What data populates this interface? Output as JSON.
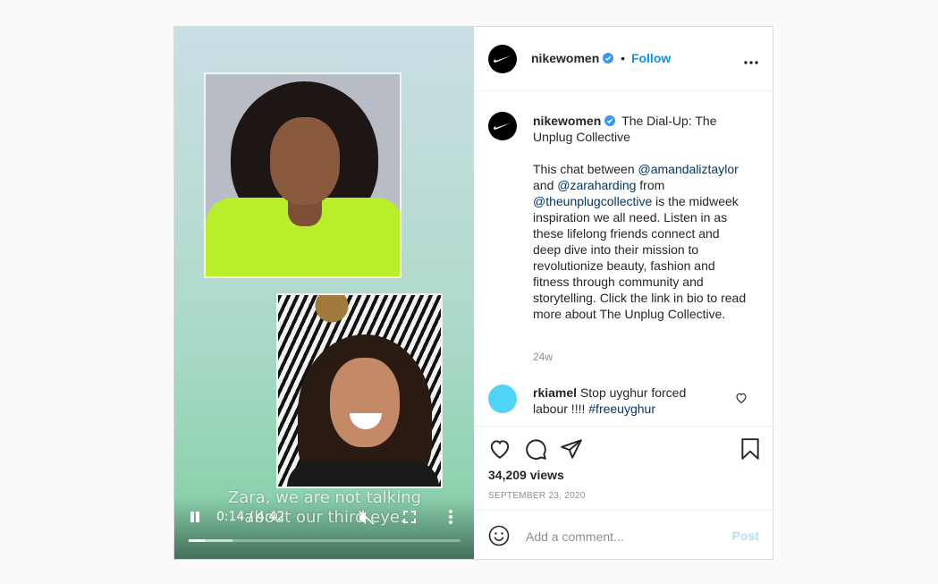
{
  "video": {
    "caption_line1": "Zara, we are not talking",
    "caption_line2": "about our third eye.",
    "time": "0:14 / 4:42",
    "progress_played": 0.06,
    "progress_buffered": 0.16
  },
  "header": {
    "username": "nikewomen",
    "separator": "•",
    "follow_label": "Follow",
    "more_icon": "more-horizontal-icon"
  },
  "post": {
    "username": "nikewomen",
    "title": "The Dial-Up: The Unplug Collective",
    "body_intro": "This chat between ",
    "mention1": "@amandaliztaylor",
    "body_and": " and ",
    "mention2": "@zaraharding",
    "body_from": " from ",
    "mention3": "@theunplugcollective",
    "body_rest": " is the midweek inspiration we all need. Listen in as these lifelong friends connect and deep dive into their mission to revolutionize beauty, fashion and fitness through community and storytelling. Click the link in bio to read more about The Unplug Collective.",
    "age": "24w"
  },
  "comment": {
    "username": "rkiamel",
    "text": "Stop uyghur forced labour !!!! ",
    "hashtag": "#freeuyghur",
    "avatar_color": "#4fd3f7"
  },
  "stats": {
    "views": "34,209 views",
    "date": "SEPTEMBER 23, 2020"
  },
  "add_comment": {
    "placeholder": "Add a comment...",
    "post_label": "Post"
  },
  "colors": {
    "accent": "#0095f6",
    "link": "#00376b",
    "post_disabled": "#b2dffc"
  }
}
